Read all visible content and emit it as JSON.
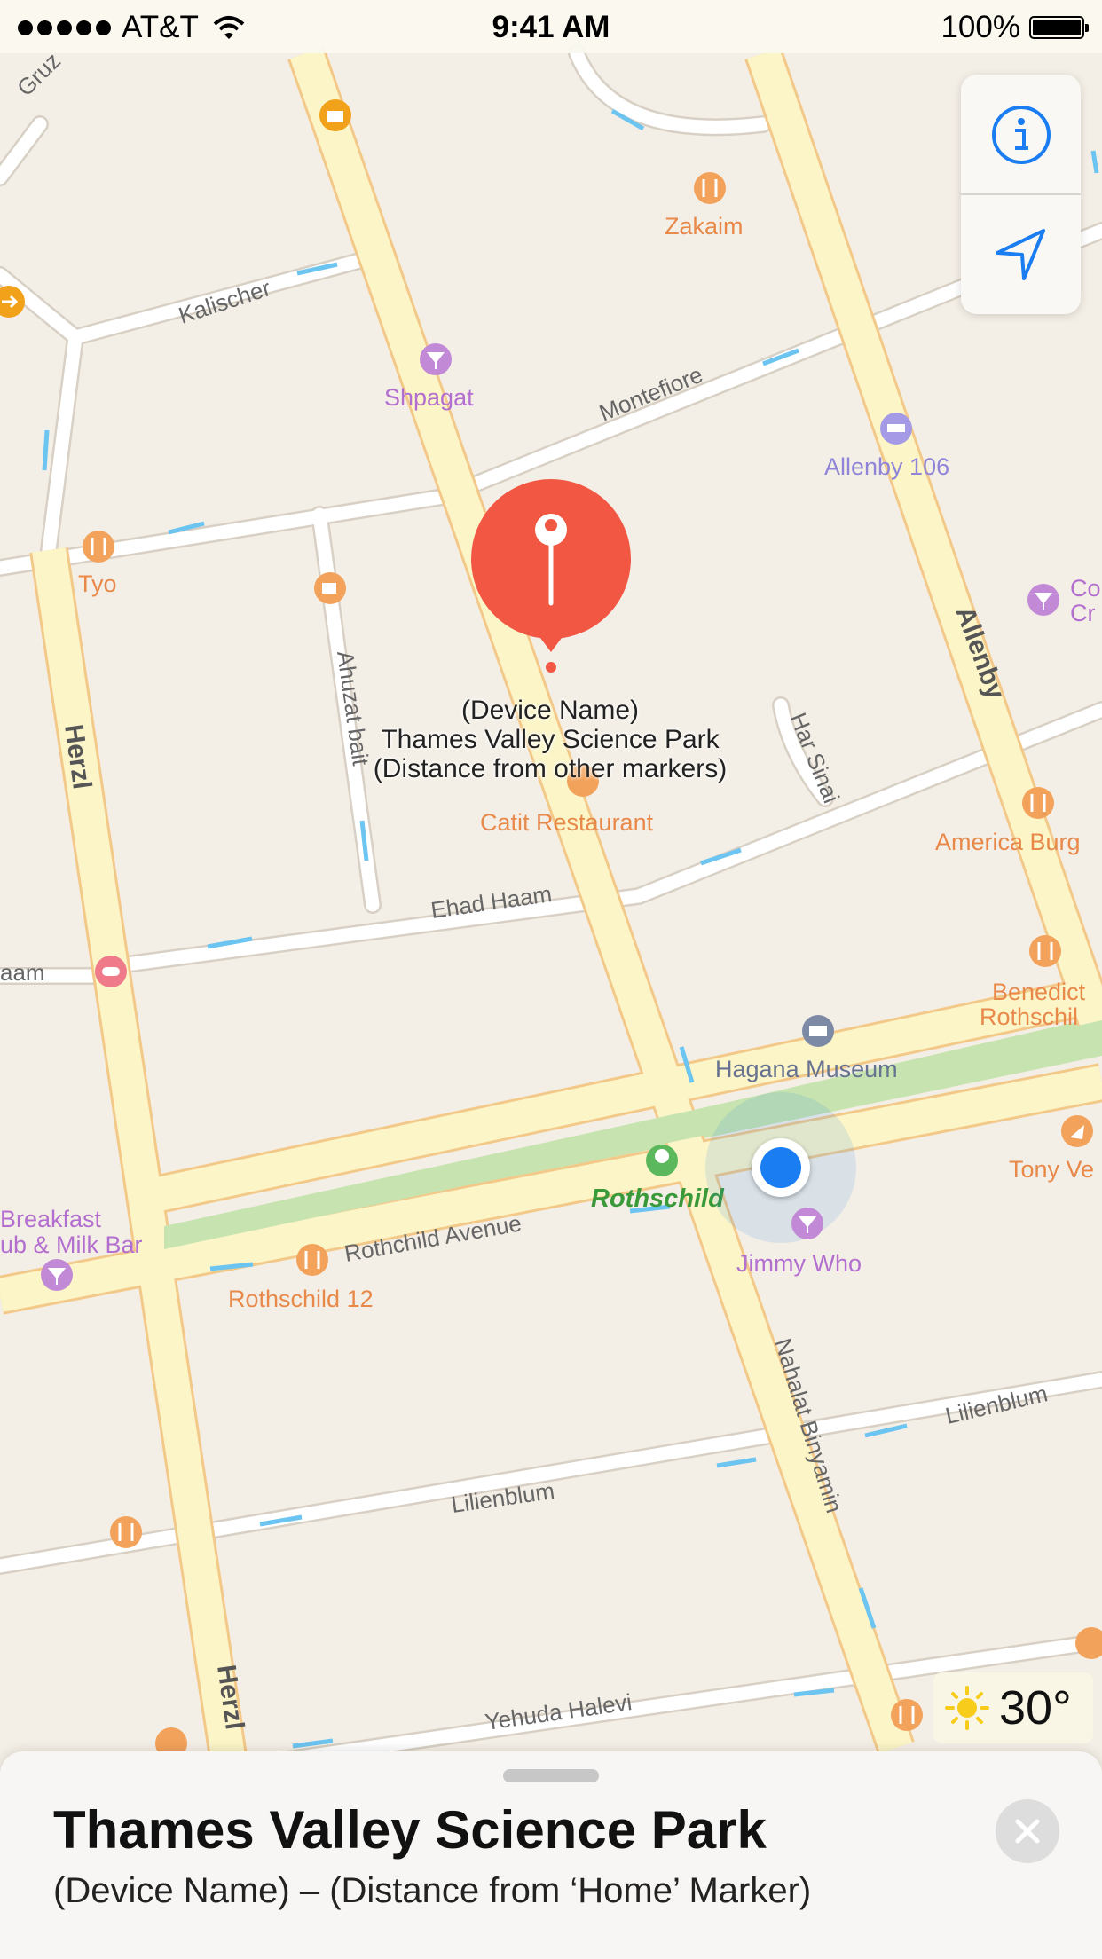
{
  "status_bar": {
    "carrier": "AT&T",
    "time": "9:41 AM",
    "battery": "100%"
  },
  "map_controls": {
    "info_icon": "info-icon",
    "location_icon": "location-arrow-icon"
  },
  "streets": {
    "gruz": "Gruz",
    "kalischer": "Kalischer",
    "montefiore": "Montefiore",
    "allenby": "Allenby",
    "herzl": "Herzl",
    "ahuzat_bait": "Ahuzat bait",
    "har_sinai": "Har Sinai",
    "ehad_haam": "Ehad Haam",
    "haam": "aam",
    "rothchild_avenue": "Rothchild Avenue",
    "nahalat_binyamin": "Nahalat Binyamin",
    "lilienblum": "Lilienblum",
    "yehuda_halevi": "Yehuda Halevi"
  },
  "pois": {
    "zakaim": "Zakaim",
    "shpagat": "Shpagat",
    "allenby_106": "Allenby 106",
    "tyo": "Tyo",
    "co_cr_1": "Co",
    "co_cr_2": "Cr",
    "catit_restaurant": "Catit Restaurant",
    "america_burg": "America Burg",
    "benedict_1": "Benedict",
    "benedict_2": "Rothschil",
    "hagana_museum": "Hagana Museum",
    "tony_ve": "Tony Ve",
    "rothschild": "Rothschild",
    "breakfast_1": "Breakfast",
    "breakfast_2": "ub & Milk Bar",
    "jimmy_who": "Jimmy Who",
    "rothschild_12": "Rothschild 12"
  },
  "pin_label": {
    "line1": "(Device Name)",
    "line2": "Thames Valley Science Park",
    "line3": "(Distance from other markers)"
  },
  "weather": {
    "icon": "sun-icon",
    "temperature": "30°"
  },
  "sheet": {
    "title": "Thames Valley Science Park",
    "subtitle": "(Device Name) – (Distance from ‘Home’ Marker)",
    "close_icon": "close-icon"
  },
  "colors": {
    "map_bg": "#f4efe6",
    "major_road": "#fbf5c8",
    "major_road_edge": "#f3c98a",
    "minor_road": "#ffffff",
    "park": "#c7e4b0",
    "food": "#f2a25a",
    "nightlife": "#c289d6",
    "hotel": "#a49ae5",
    "pin": "#f25744",
    "user_location": "#1a7df2",
    "accent": "#1a7df2"
  }
}
